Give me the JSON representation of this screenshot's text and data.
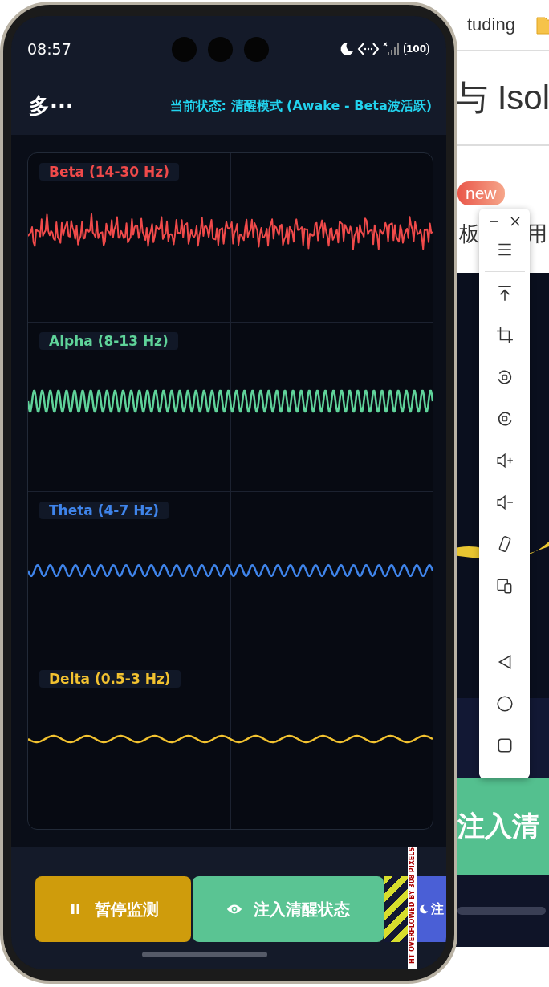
{
  "desktop": {
    "tab_text": "tuding",
    "heading": "与 Isol",
    "badge": "new",
    "text_1": "板",
    "text_2": "用",
    "preview_button": "注入清"
  },
  "phone": {
    "status_bar": {
      "time": "08:57",
      "battery": "100"
    },
    "app_bar": {
      "title": "多···",
      "status": "当前状态: 清醒模式 (Awake - Beta波活跃)"
    },
    "channels": [
      {
        "label": "Beta (14-30 Hz)",
        "color": "#f04a4a"
      },
      {
        "label": "Alpha (8-13 Hz)",
        "color": "#5fd39a"
      },
      {
        "label": "Theta (4-7 Hz)",
        "color": "#3f84ea"
      },
      {
        "label": "Delta (0.5-3 Hz)",
        "color": "#f2c230"
      }
    ],
    "buttons": [
      {
        "kind": "pause",
        "label": "暂停监测",
        "color": "#cf9c0c"
      },
      {
        "kind": "eye",
        "label": "注入清醒状态",
        "color": "#5ac493"
      },
      {
        "kind": "moon",
        "label": "注",
        "color": "#4a5fd6"
      }
    ],
    "overflow_warning": "HT OVERFLOWED BY 308 PIXELS"
  }
}
